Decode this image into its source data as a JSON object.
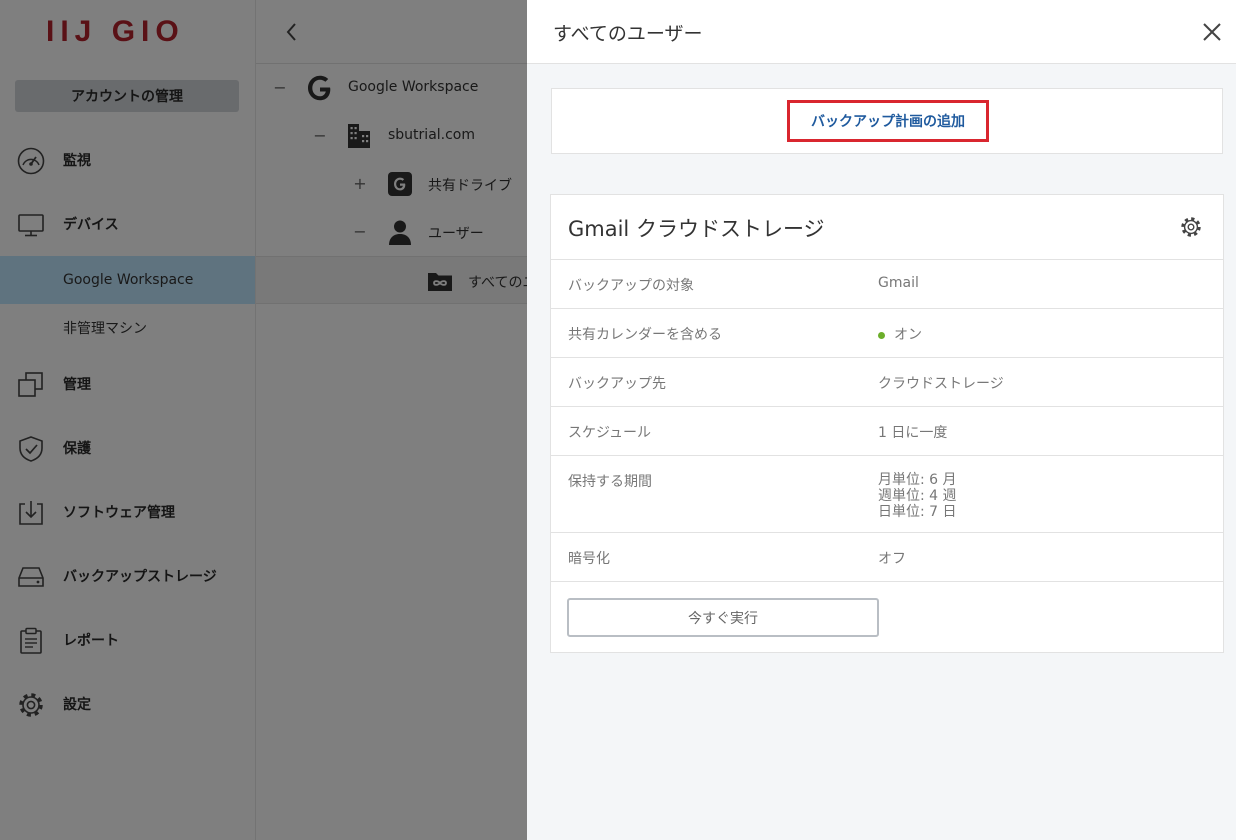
{
  "sidebar": {
    "logo_text": "IIJ GIO",
    "account_button": "アカウントの管理",
    "nav": {
      "monitor": "監視",
      "devices": "デバイス",
      "management": "管理",
      "protection": "保護",
      "software": "ソフトウェア管理",
      "backup_storage": "バックアップストレージ",
      "reports": "レポート",
      "settings": "設定"
    },
    "sub": {
      "google_workspace": "Google Workspace",
      "unmanaged": "非管理マシン"
    },
    "brand_color": "#b4232d"
  },
  "tree": {
    "root": {
      "toggle": "−",
      "label": "Google Workspace"
    },
    "domain": {
      "toggle": "−",
      "label": "sbutrial.com"
    },
    "shared_drive": {
      "toggle": "+",
      "label": "共有ドライブ"
    },
    "users": {
      "toggle": "−",
      "label": "ユーザー"
    },
    "all_users": {
      "label": "すべてのユーザー"
    }
  },
  "panel": {
    "title": "すべてのユーザー",
    "add_plan_button": "バックアップ計画の追加",
    "highlight_color": "#d9262f",
    "plan": {
      "title": "Gmail クラウドストレージ",
      "rows": [
        {
          "key": "バックアップの対象",
          "value": "Gmail"
        },
        {
          "key": "共有カレンダーを含める",
          "value": "オン",
          "status_color": "#6cae2a"
        },
        {
          "key": "バックアップ先",
          "value": "クラウドストレージ"
        },
        {
          "key": "スケジュール",
          "value": "1 日に一度"
        },
        {
          "key": "保持する期間",
          "values": [
            "月単位: 6 月",
            "週単位: 4 週",
            "日単位: 7 日"
          ]
        },
        {
          "key": "暗号化",
          "value": "オフ"
        }
      ],
      "run_button": "今すぐ実行"
    }
  }
}
